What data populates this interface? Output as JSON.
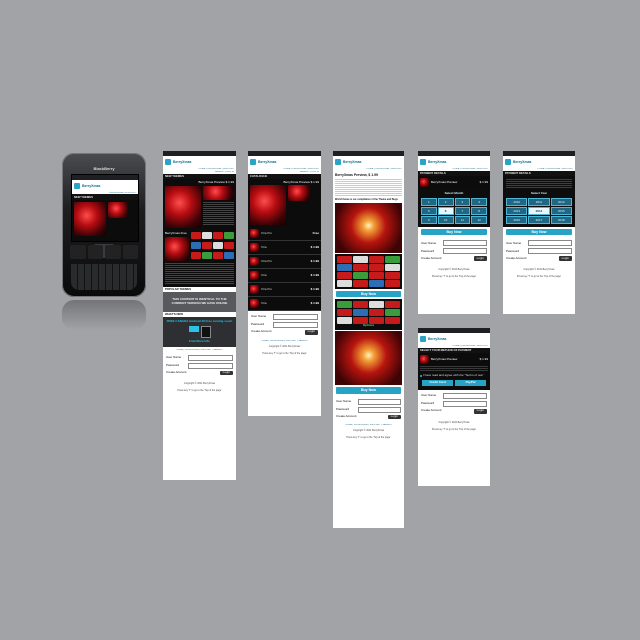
{
  "phone": {
    "brand": "BlackBerry",
    "screen_title": "BerryXmas",
    "screen_section": "NEW THEMES",
    "screen_nav": "CATALOGUE | ACCOUNT"
  },
  "common": {
    "logo": "BerryXmas",
    "nav_top": "HOME | CATALOGUE | SUPPORT",
    "nav_sub": "SEARCH | LOG IN",
    "username_label": "User Name",
    "password_label": "Password",
    "create_account": "Create Account",
    "login_button": "Login",
    "footer_nav": "HOME | CATALOGUE | SUPPORT | SEARCH",
    "copyright": "Copyright © 2011 BerryXmas",
    "footer_hint": "Press key 'T' to go to the 'Top of the page'",
    "buy_now": "Buy Now"
  },
  "screen1": {
    "section_new": "NEW THEMES",
    "product_title": "BerryXmas Preview",
    "product_price": "$ 1.99",
    "product_name_short": "BerryXmas Free",
    "popular_title": "POPULAR THEMES",
    "popular_notice": "THIS CONTENT IS IDENTICAL TO THE CURRENT VERSION WE HAVE ONLINE",
    "whats_new": "WHAT'S NEW",
    "promo_headline": "FREE CANADA Android 40 Free coming soon!",
    "promo_find_more": "Find More Info"
  },
  "screen2": {
    "section": "CATALOGUE",
    "featured_title": "BerryXmas Preview",
    "featured_price": "$ 1.99",
    "items": [
      {
        "name": "Xtra Pro",
        "price": "Free"
      },
      {
        "name": "Xtra",
        "price": "$ 1.99"
      },
      {
        "name": "Xtra Pro",
        "price": "$ 1.99"
      },
      {
        "name": "Xtra",
        "price": "$ 1.99"
      },
      {
        "name": "Xtra Pro",
        "price": "$ 1.99"
      },
      {
        "name": "Xtra",
        "price": "$ 1.99"
      }
    ]
  },
  "screen3": {
    "title": "BerryXmas Preview, $ 1.99",
    "subtitle": "World theme is our compilation of the Theme and Bugs",
    "options_label": "Options"
  },
  "screen4": {
    "section": "PAYMENT DETAILS",
    "product_title": "BerryXmas Preview",
    "product_price": "$ 1.99",
    "select_month": "Select Month",
    "months": [
      "1",
      "2",
      "3",
      "4",
      "5",
      "6",
      "7",
      "8",
      "9",
      "10",
      "11",
      "12"
    ],
    "selected_month": "6"
  },
  "screen5": {
    "section": "PAYMENT DETAILS",
    "select_year": "Select Year",
    "years": [
      "2010",
      "2011",
      "2012",
      "2013",
      "2014",
      "2015",
      "2016",
      "2017",
      "2018"
    ],
    "selected_year": "2014"
  },
  "screen6": {
    "section": "SELECT YOUR METHOD OF PAYMENT",
    "product_title": "BerryXmas Preview",
    "product_price": "$ 1.99",
    "option_terms": "I have read and agree with the \"Terms of use\"",
    "credit_card": "Credit Card",
    "paypal": "PayPal"
  }
}
